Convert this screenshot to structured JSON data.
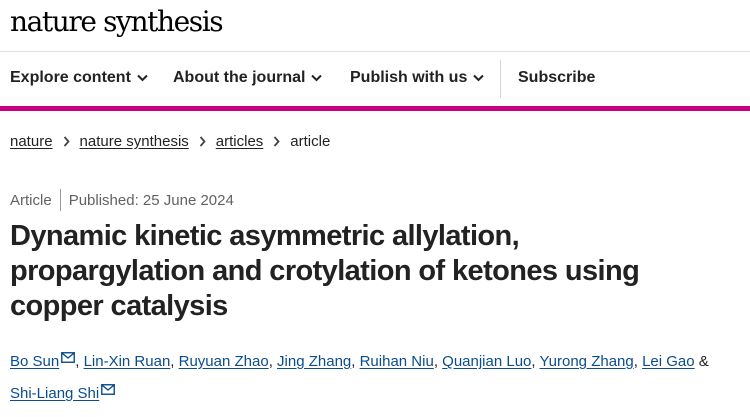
{
  "header": {
    "logo_text": "nature synthesis"
  },
  "nav": {
    "items": [
      {
        "label": "Explore content"
      },
      {
        "label": "About the journal"
      },
      {
        "label": "Publish with us"
      }
    ],
    "subscribe_label": "Subscribe"
  },
  "breadcrumb": {
    "items": [
      "nature",
      "nature synthesis",
      "articles"
    ],
    "current": "article"
  },
  "article": {
    "type": "Article",
    "published": "Published: 25 June 2024",
    "title": "Dynamic kinetic asymmetric allylation, propargylation and crotylation of ketones using copper catalysis",
    "authors": [
      "Bo Sun",
      "Lin-Xin Ruan",
      "Ruyuan Zhao",
      "Jing Zhang",
      "Ruihan Niu",
      "Quanjian Luo",
      "Yurong Zhang",
      "Lei Gao",
      "Shi-Liang Shi"
    ],
    "author_separator": ",",
    "last_author_conjunction": "&"
  },
  "icons": {
    "nav_chevron": "chevron-down-icon",
    "breadcrumb_chevron": "chevron-right-icon",
    "email": "envelope-icon"
  },
  "colors": {
    "accent": "#c6007e",
    "link": "#0b4d8c",
    "text": "#222222",
    "muted": "#626262"
  }
}
